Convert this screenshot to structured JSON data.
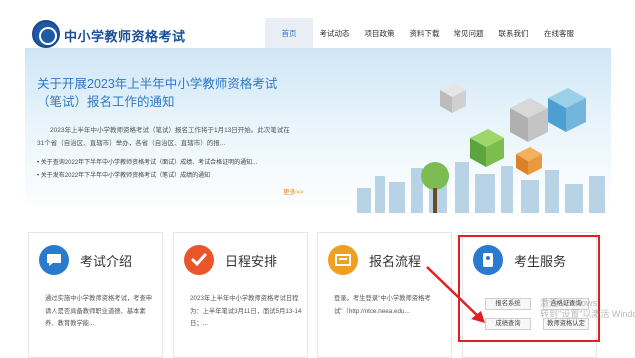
{
  "site": {
    "title": "中小学教师资格考试"
  },
  "nav": [
    {
      "label": "首页",
      "active": true
    },
    {
      "label": "考试动态",
      "active": false
    },
    {
      "label": "项目政策",
      "active": false
    },
    {
      "label": "资料下载",
      "active": false
    },
    {
      "label": "常见问题",
      "active": false
    },
    {
      "label": "联系我们",
      "active": false
    },
    {
      "label": "在线客服",
      "active": false
    }
  ],
  "banner": {
    "title": "关于开展2023年上半年中小学教师资格考试（笔试）报名工作的通知",
    "intro": "2023年上半年中小学教师资格考试（笔试）报名工作将于1月13日开始。此次笔试在31个省（自治区、直辖市）举办，各省（自治区、直辖市）的报...",
    "news": [
      "关于查询2022年下半年中小学教师资格考试（面试）成绩、考试合格证明的通知...",
      "关于发布2022年下半年中小学教师资格考试（笔试）成绩的通知"
    ],
    "more": "更多>>"
  },
  "cards": [
    {
      "title": "考试介绍",
      "desc": "通过实施中小学教师资格考试，考查申请人是否具备教师职业道德、基本素养、教育教学能...",
      "icon": "speech-bubble-icon",
      "color": "#2a7bd0"
    },
    {
      "title": "日程安排",
      "desc": "2023年上半年中小学教师资格考试日程为：上半年笔试3月11日，面试5月13-14日；...",
      "icon": "checkmark-icon",
      "color": "#e8562a"
    },
    {
      "title": "报名流程",
      "desc": "登录。考生登录\"中小学教师资格考试\"（http://ntce.neea.edu...",
      "icon": "id-card-icon",
      "color": "#f0a020"
    },
    {
      "title": "考生服务",
      "icon": "contact-card-icon",
      "color": "#2a7bd0"
    }
  ],
  "services": [
    "报名系统",
    "合格证查询",
    "成绩查询",
    "教师资格认定"
  ],
  "watermark": {
    "line1": "激活 Windows",
    "line2": "转到\"设置\"以激活 Windows。"
  }
}
